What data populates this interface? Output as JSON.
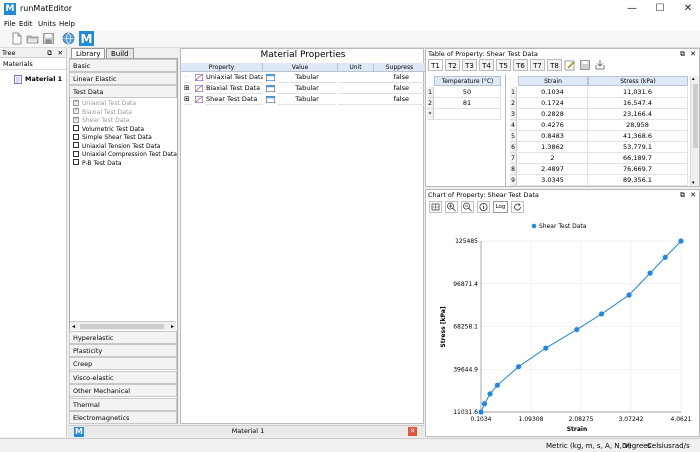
{
  "app": {
    "title": "runMatEditor",
    "icon_letter": "M"
  },
  "menu": [
    "File",
    "Edit",
    "Units",
    "Help"
  ],
  "tree": {
    "header": "Tree",
    "column": "Materials",
    "items": [
      "Material 1"
    ]
  },
  "library": {
    "tabs": [
      "Library",
      "Build"
    ],
    "categories_top": [
      "Basic",
      "Linear Elastic",
      "Test Data"
    ],
    "test_data_items": [
      {
        "label": "Uniaxial Test Data",
        "checked": true,
        "disabled": true
      },
      {
        "label": "Biaxial Test Data",
        "checked": true,
        "disabled": true
      },
      {
        "label": "Shear Test Data",
        "checked": true,
        "disabled": true
      },
      {
        "label": "Volumetric Test Data",
        "checked": false,
        "disabled": false
      },
      {
        "label": "Simple Shear Test Data",
        "checked": false,
        "disabled": false
      },
      {
        "label": "Uniaxial Tension Test Data",
        "checked": false,
        "disabled": false
      },
      {
        "label": "Uniaxial Compression Test Data",
        "checked": false,
        "disabled": false
      },
      {
        "label": "P-B Test Data",
        "checked": false,
        "disabled": false
      }
    ],
    "categories_bottom": [
      "Hyperelastic",
      "Plasticity",
      "Creep",
      "Visco-elastic",
      "Other Mechanical",
      "Thermal",
      "Electromagnetics"
    ]
  },
  "material_properties": {
    "title": "Material Properties",
    "columns": [
      "Property",
      "Value",
      "Unit",
      "Suppress"
    ],
    "rows": [
      {
        "property": "Uniaxial Test Data",
        "value": "Tabular",
        "unit": "",
        "suppress": "false"
      },
      {
        "property": "Biaxial Test Data",
        "value": "Tabular",
        "unit": "",
        "suppress": "false"
      },
      {
        "property": "Shear Test Data",
        "value": "Tabular",
        "unit": "",
        "suppress": "false"
      }
    ]
  },
  "table_of_property": {
    "title": "Table of Property: Shear Test Data",
    "tabs": [
      "T1",
      "T2",
      "T3",
      "T4",
      "T5",
      "T6",
      "T7",
      "T8"
    ],
    "temperature": {
      "header": "Temperature (°C)",
      "rows": [
        "50",
        "81"
      ]
    },
    "data": {
      "headers": [
        "Strain",
        "Stress (kPa)"
      ],
      "rows": [
        [
          "0.1034",
          "11,031.6"
        ],
        [
          "0.1724",
          "16,547.4"
        ],
        [
          "0.2828",
          "23,166.4"
        ],
        [
          "0.4276",
          "28,958"
        ],
        [
          "0.8483",
          "41,368.6"
        ],
        [
          "1.3862",
          "53,779.1"
        ],
        [
          "2",
          "66,189.7"
        ],
        [
          "2.4897",
          "76,669.7"
        ],
        [
          "3.0345",
          "89,356.1"
        ]
      ]
    }
  },
  "chart_panel": {
    "title": "Chart of Property: Shear Test Data",
    "log_label": "Log"
  },
  "chart_data": {
    "type": "line",
    "title": "",
    "xlabel": "Strain",
    "ylabel": "Stress [kPa]",
    "xlim": [
      0.1034,
      4.0621
    ],
    "ylim": [
      11031.6,
      125485
    ],
    "xticks": [
      "0.1034",
      "1.09308",
      "2.08275",
      "3.07242",
      "4.0621"
    ],
    "yticks": [
      "11031.6",
      "39644.9",
      "68258.1",
      "96871.4",
      "125485"
    ],
    "legend": "top-center",
    "grid": true,
    "color": "#1e88e5",
    "series": [
      {
        "name": "Shear Test Data",
        "x": [
          0.1034,
          0.1724,
          0.2828,
          0.4276,
          0.8483,
          1.3862,
          2.0,
          2.4897,
          3.0345,
          3.45,
          3.75,
          4.0621
        ],
        "y": [
          11031.6,
          16547.4,
          23166.4,
          28958,
          41368.6,
          53779.1,
          66189.7,
          76669.7,
          89356.1,
          104000,
          114500,
          125485
        ]
      }
    ]
  },
  "doc_tab": {
    "label": "Material 1"
  },
  "status": [
    "Metric (kg, m, s, A, N, V)",
    "Degrees",
    "Celsius",
    "rad/s"
  ]
}
